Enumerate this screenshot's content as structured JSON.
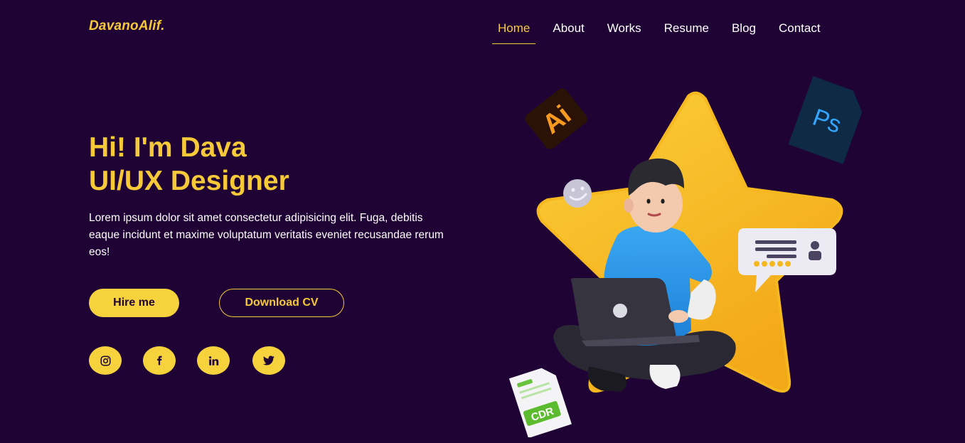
{
  "brand": {
    "logo": "DavanoAlif."
  },
  "nav": {
    "items": [
      {
        "label": "Home",
        "active": true
      },
      {
        "label": "About",
        "active": false
      },
      {
        "label": "Works",
        "active": false
      },
      {
        "label": "Resume",
        "active": false
      },
      {
        "label": "Blog",
        "active": false
      },
      {
        "label": "Contact",
        "active": false
      }
    ]
  },
  "hero": {
    "title_line1": "Hi! I'm Dava",
    "title_line2": "UI/UX Designer",
    "description": "Lorem ipsum dolor sit amet consectetur adipisicing elit. Fuga, debitis eaque incidunt et maxime voluptatum veritatis eveniet recusandae rerum eos!",
    "hire_label": "Hire me",
    "cv_label": "Download CV"
  },
  "social": {
    "icons": [
      "instagram-icon",
      "facebook-icon",
      "linkedin-icon",
      "twitter-icon"
    ]
  },
  "illustration": {
    "ai_label": "Ai",
    "ps_label": "Ps",
    "cdr_label": "CDR"
  },
  "colors": {
    "background": "#1f0335",
    "accent": "#f6c938",
    "button": "#f6d33c"
  }
}
